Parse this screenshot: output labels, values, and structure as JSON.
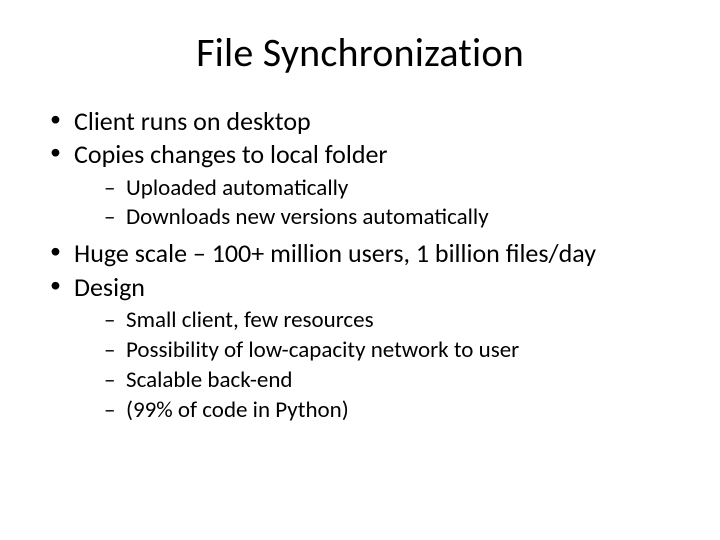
{
  "title": "File Synchronization",
  "bullets": {
    "b1": "Client runs on desktop",
    "b2": "Copies changes to local folder",
    "b2_subs": {
      "s1": "Uploaded automatically",
      "s2": "Downloads new versions automatically"
    },
    "b3": "Huge scale – 100+ million users, 1 billion files/day",
    "b4": "Design",
    "b4_subs": {
      "s1": "Small client, few resources",
      "s2": "Possibility of low-capacity network to user",
      "s3": "Scalable back-end",
      "s4": "(99% of code in Python)"
    }
  }
}
